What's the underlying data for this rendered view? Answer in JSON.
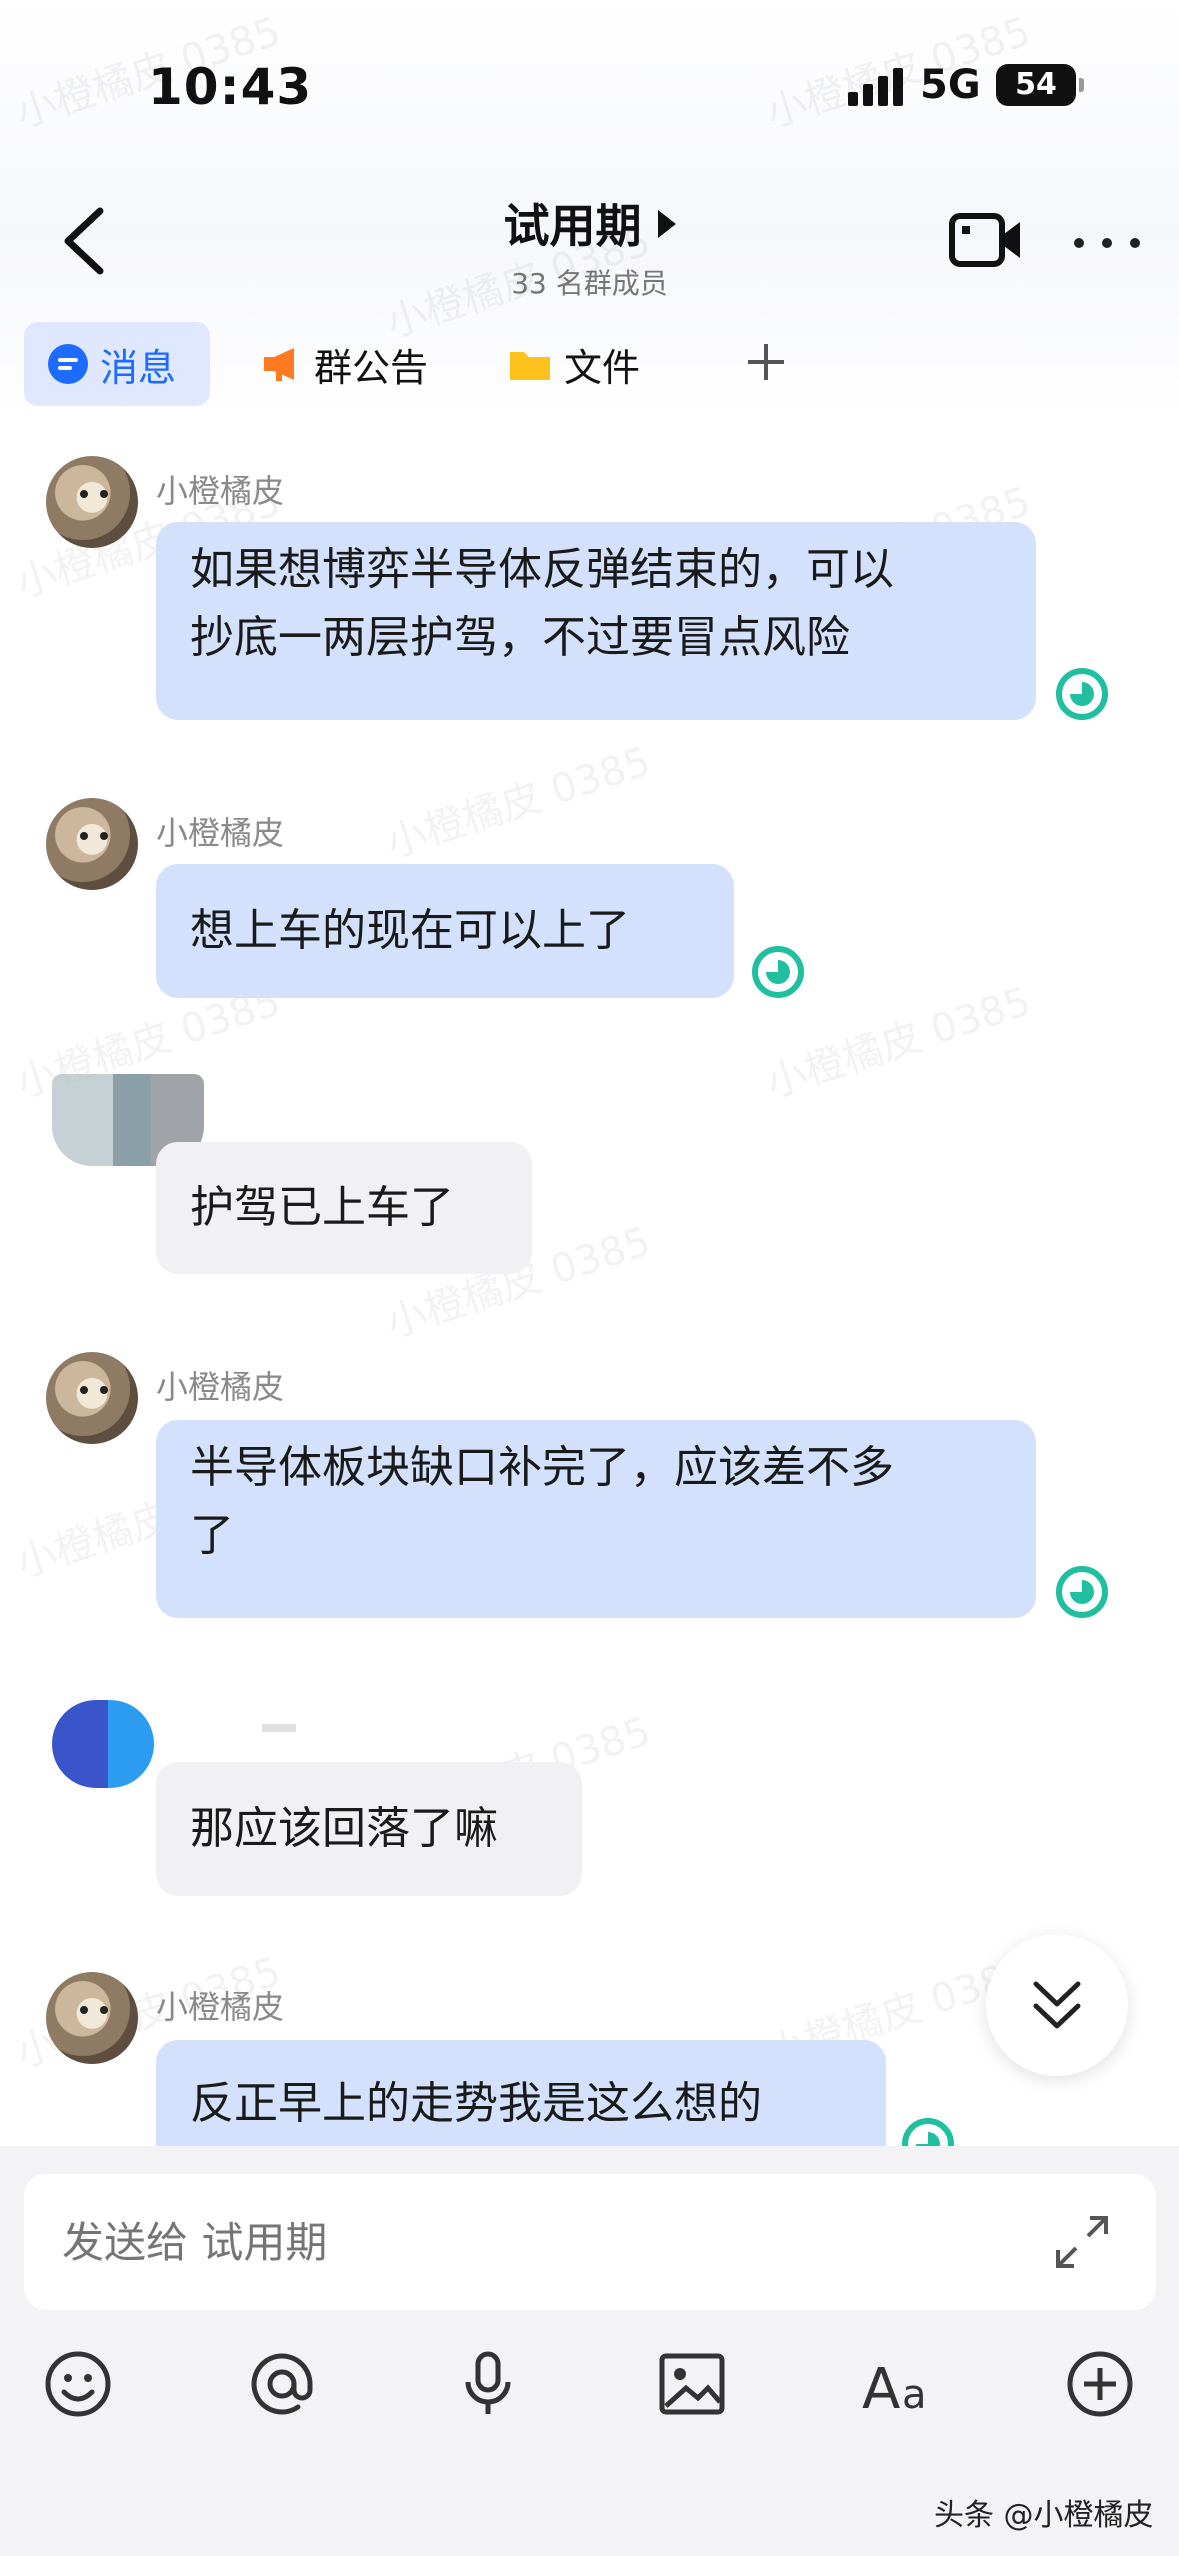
{
  "status_bar": {
    "time": "10:43",
    "network": "5G",
    "battery": "54"
  },
  "header": {
    "title": "试用期",
    "subtitle": "33 名群成员"
  },
  "tabs": [
    {
      "label": "消息"
    },
    {
      "label": "群公告"
    },
    {
      "label": "文件"
    }
  ],
  "messages": [
    {
      "sender": "小橙橘皮",
      "line1": "如果想博弈半导体反弹结束的，可以",
      "line2": "抄底一两层护驾，不过要冒点风险"
    },
    {
      "sender": "小橙橘皮",
      "line1": "想上车的现在可以上了"
    },
    {
      "line1": "护驾已上车了"
    },
    {
      "sender": "小橙橘皮",
      "line1": "半导体板块缺口补完了，应该差不多",
      "line2": "了"
    },
    {
      "line1": "那应该回落了嘛"
    },
    {
      "sender": "小橙橘皮",
      "line1": "反正早上的走势我是这么想的"
    }
  ],
  "composer": {
    "placeholder": "发送给 试用期"
  },
  "watermark": "小橙橘皮 0385",
  "footer": "头条 @小橙橘皮",
  "colors": {
    "accent": "#1d6bff",
    "bubble_self": "#d3e1fc",
    "bubble_other": "#f1f1f3",
    "read_indicator": "#1fbf9f"
  }
}
